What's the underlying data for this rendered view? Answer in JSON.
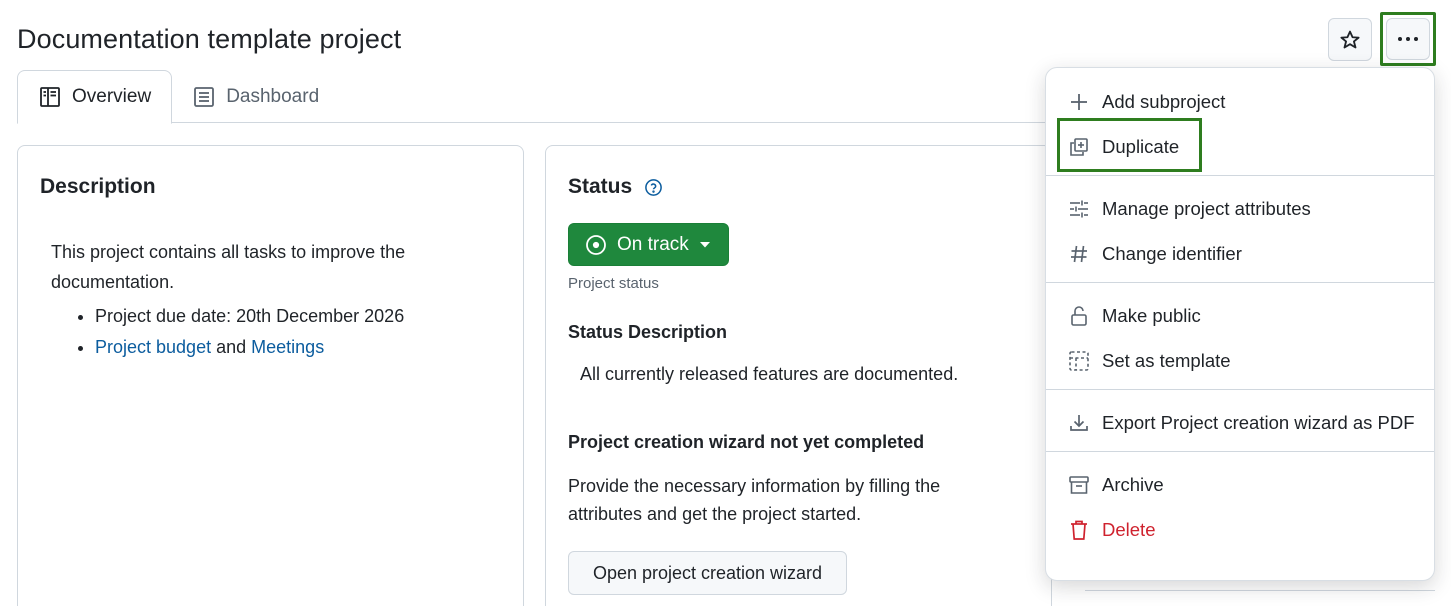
{
  "page": {
    "title": "Documentation template project"
  },
  "header": {
    "star_icon": "star-icon",
    "more_icon": "more-horizontal-icon"
  },
  "tabs": [
    {
      "label": "Overview",
      "icon": "book-icon",
      "active": true
    },
    {
      "label": "Dashboard",
      "icon": "list-icon",
      "active": false
    }
  ],
  "description": {
    "title": "Description",
    "text": "This project contains all tasks to improve the documentation.",
    "bullet1": "Project due date: 20th December 2026",
    "link_budget": "Project budget",
    "and_word": "and",
    "link_meetings": "Meetings"
  },
  "status": {
    "title": "Status",
    "help_icon": "help-circle-icon",
    "value": "On track",
    "caption": "Project status",
    "desc_heading": "Status Description",
    "desc_text": "All currently released features are documented.",
    "wizard_heading": "Project creation wizard not yet completed",
    "wizard_text": "Provide the necessary information by filling the attributes and get the project started.",
    "wizard_button": "Open project creation wizard",
    "colors": {
      "ok": "#1f883d"
    }
  },
  "menu": {
    "items": [
      {
        "label": "Add subproject",
        "icon": "plus-icon"
      },
      {
        "label": "Duplicate",
        "icon": "duplicate-icon"
      },
      {
        "label": "Manage project attributes",
        "icon": "sliders-icon"
      },
      {
        "label": "Change identifier",
        "icon": "hash-icon"
      },
      {
        "label": "Make public",
        "icon": "unlock-icon"
      },
      {
        "label": "Set as template",
        "icon": "template-icon"
      },
      {
        "label": "Export Project creation wizard as PDF",
        "icon": "download-icon"
      },
      {
        "label": "Archive",
        "icon": "archive-icon"
      },
      {
        "label": "Delete",
        "icon": "trash-icon"
      }
    ]
  }
}
